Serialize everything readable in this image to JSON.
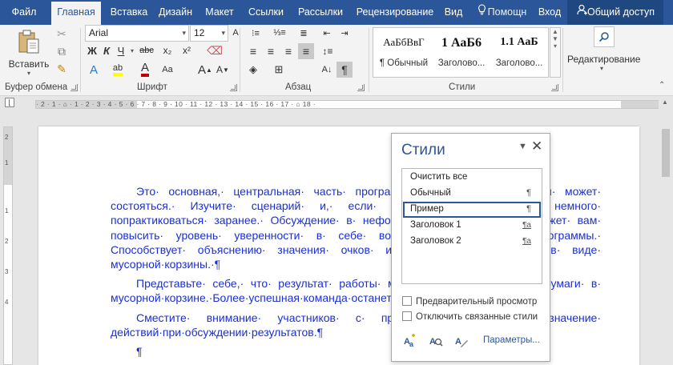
{
  "tabs": [
    {
      "label": "Файл"
    },
    {
      "label": "Главная",
      "active": true
    },
    {
      "label": "Вставка"
    },
    {
      "label": "Дизайн"
    },
    {
      "label": "Макет"
    },
    {
      "label": "Ссылки"
    },
    {
      "label": "Рассылки"
    },
    {
      "label": "Рецензирование"
    },
    {
      "label": "Вид"
    },
    {
      "label": "Помощн"
    },
    {
      "label": "Вход"
    },
    {
      "label": "Общий доступ"
    }
  ],
  "ribbon": {
    "clipboard": {
      "paste_label": "Вставить",
      "group_label": "Буфер обмена"
    },
    "font": {
      "name": "Arial",
      "size": "12",
      "group_label": "Шрифт",
      "bold": "Ж",
      "italic": "К",
      "underline": "Ч",
      "strike": "abc",
      "subscript": "x₂",
      "superscript": "x²"
    },
    "paragraph": {
      "group_label": "Абзац",
      "show_marks": "¶"
    },
    "styles": {
      "group_label": "Стили",
      "gallery": [
        {
          "sample": "АаБбВвГ",
          "name": "¶ Обычный"
        },
        {
          "sample": "1  АаБ6",
          "name": "Заголово..."
        },
        {
          "sample": "1.1  АаБ",
          "name": "Заголово..."
        }
      ]
    },
    "editing": {
      "label": "Редактирование"
    }
  },
  "ruler": {
    "marks": "· 2 · 1 · ⌂ · 1 · 2 · 3 · 4 · 5 · 6 · 7 · 8 · 9 · 10 · 11 · 12 · 13 · 14 · 15 · 16 · 17 · ⌂ 18 ·"
  },
  "vruler": {
    "marks": [
      "2",
      "1",
      "1",
      "2",
      "3",
      "4"
    ]
  },
  "document": {
    "paragraphs": [
      "Это· основная,· центральная· часть· программы· выступления,· которая· может· состояться.· Изучите· сценарий· и,· если· возможно,· постарайтесь· немного· попрактиковаться· заранее.· Обсуждение· в· неформальной· обстановке· поможет· вам· повысить· уровень· уверенности· в· себе· во· время· выполнения· программы.· Способствует· объяснению· значения· очков· их· зрителям· и· бумаги· в· виде· мусорной·корзины.·¶",
      "Представьте· себе,· что· результат· работы· может· оказаться· в· виде· бумаги· в· мусорной·корзине.·Более·успешная·команда·останется·без·такого·мусора.¶",
      "Сместите· внимание· участников· с· процедуры· на· важное· значение· действий·при·обсуждении·результатов.¶",
      "¶"
    ]
  },
  "styles_pane": {
    "title": "Стили",
    "items": [
      {
        "name": "Очистить все",
        "mark": ""
      },
      {
        "name": "Обычный",
        "mark": "¶"
      },
      {
        "name": "Пример",
        "mark": "¶",
        "selected": true
      },
      {
        "name": "Заголовок 1",
        "mark": "¶a"
      },
      {
        "name": "Заголовок 2",
        "mark": "¶a"
      }
    ],
    "preview_label": "Предварительный просмотр",
    "disable_linked_label": "Отключить связанные стили",
    "options_label": "Параметры..."
  },
  "colors": {
    "accent": "#2b579a",
    "doc_text": "#1a2fd6"
  }
}
